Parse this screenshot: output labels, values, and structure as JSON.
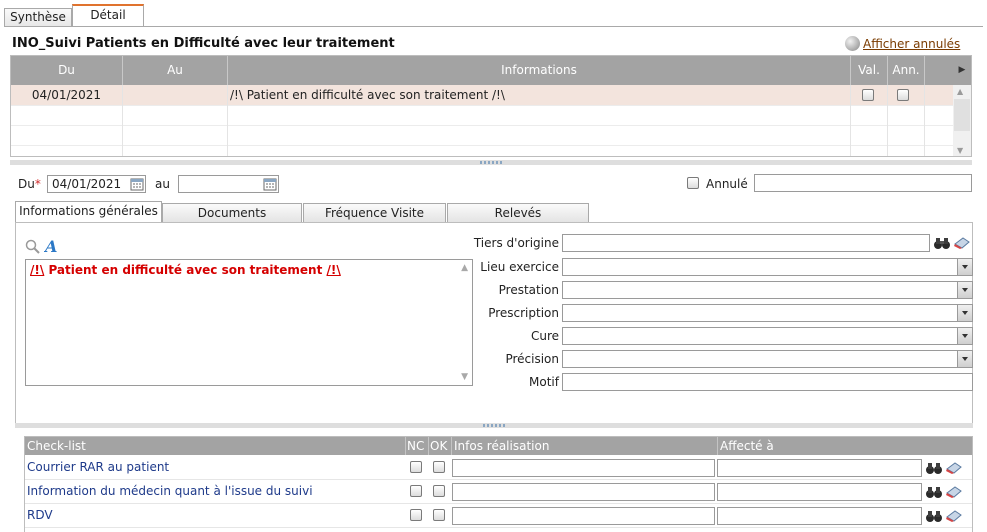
{
  "tabs": {
    "synthese": "Synthèse",
    "detail": "Détail"
  },
  "page_title": "INO_Suivi Patients en Difficulté avec leur traitement",
  "show_cancelled_label": "Afficher annulés",
  "top_grid": {
    "columns": {
      "du": "Du",
      "au": "Au",
      "informations": "Informations",
      "val": "Val.",
      "ann": "Ann."
    },
    "rows": [
      {
        "du": "04/01/2021",
        "au": "",
        "informations": "/!\\ Patient en difficulté avec son traitement /!\\",
        "val": false,
        "ann": false
      }
    ]
  },
  "date_form": {
    "du_label": "Du",
    "required_mark": "*",
    "du_value": "04/01/2021",
    "au_label": "au",
    "au_value": "",
    "annule_label": "Annulé",
    "annule_value": ""
  },
  "sub_tabs": [
    "Informations générales",
    "Documents",
    "Fréquence Visite",
    "Relevés"
  ],
  "general": {
    "note_text": "Patient en difficulté avec son traitement",
    "fields": {
      "tiers": "Tiers d'origine",
      "lieu": "Lieu exercice",
      "prestation": "Prestation",
      "prescription": "Prescription",
      "cure": "Cure",
      "precision": "Précision",
      "motif": "Motif"
    }
  },
  "checklist": {
    "columns": {
      "item": "Check-list",
      "nc": "NC",
      "ok": "OK",
      "infos": "Infos réalisation",
      "affecte": "Affecté à"
    },
    "rows": [
      {
        "label": "Courrier RAR au patient"
      },
      {
        "label": "Information du médecin quant à l'issue du suivi"
      },
      {
        "label": "RDV"
      }
    ]
  },
  "colors": {
    "accent": "#e0732e",
    "header_gray": "#a3a3a3",
    "selected_row": "#f3e4dd",
    "link": "#7a3b00",
    "warning_red": "#d50000",
    "checklist_link": "#1e3a8a"
  }
}
